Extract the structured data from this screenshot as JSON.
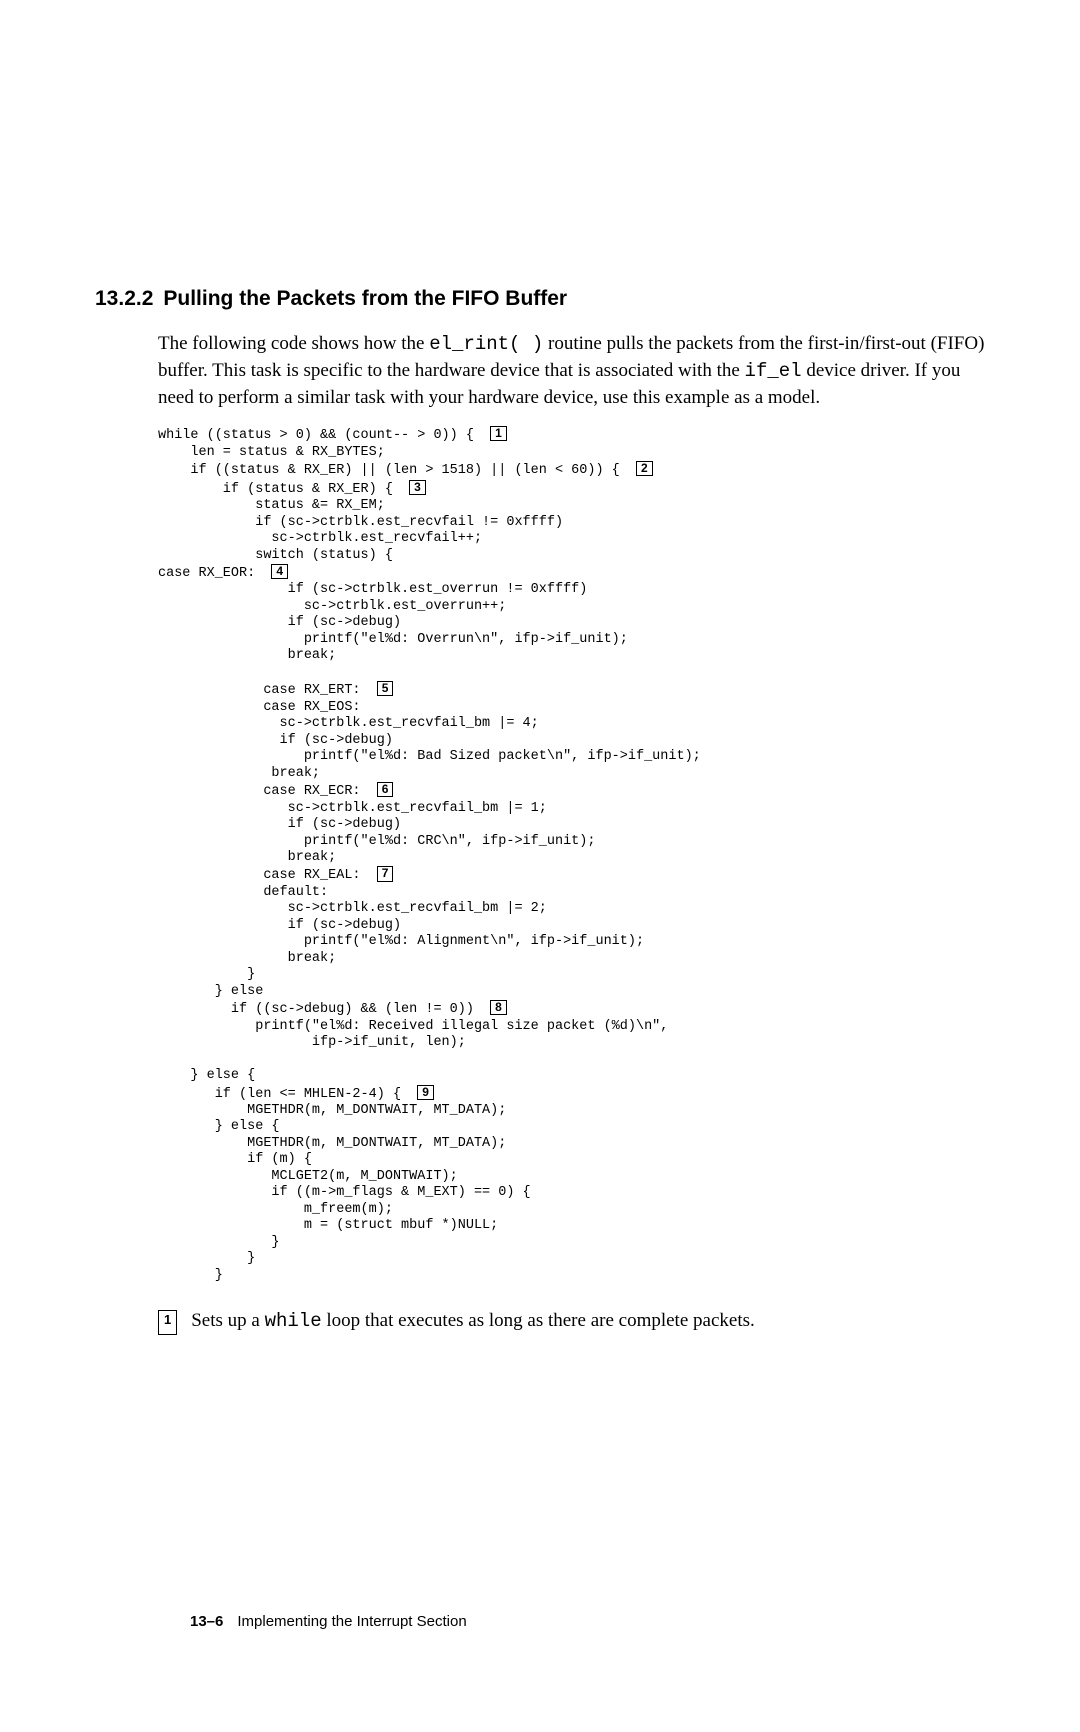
{
  "section": {
    "number": "13.2.2",
    "title": "Pulling the Packets from the FIFO Buffer"
  },
  "intro": {
    "text_before_code1": "The following code shows how the ",
    "code1": "el_rint( )",
    "text_mid1": " routine pulls the packets from the first-in/first-out (FIFO) buffer. This task is specific to the hardware device that is associated with the ",
    "code2": "if_el",
    "text_after_code2": " device driver. If you need to perform a similar task with your hardware device, use this example as a model."
  },
  "code": {
    "l1a": "while ((status > 0) && (count-- > 0)) {  ",
    "c1": "1",
    "l2": "    len = status & RX_BYTES;",
    "l3a": "    if ((status & RX_ER) || (len > 1518) || (len < 60)) {  ",
    "c2": "2",
    "l4a": "        if (status & RX_ER) {  ",
    "c3": "3",
    "l5": "            status &= RX_EM;",
    "l6": "            if (sc->ctrblk.est_recvfail != 0xffff)",
    "l7": "              sc->ctrblk.est_recvfail++;",
    "l8": "            switch (status) {",
    "l9a": "case RX_EOR:  ",
    "c4": "4",
    "l10": "                if (sc->ctrblk.est_overrun != 0xffff)",
    "l11": "                  sc->ctrblk.est_overrun++;",
    "l12": "                if (sc->debug)",
    "l13": "                  printf(\"el%d: Overrun\\n\", ifp->if_unit);",
    "l14": "                break;",
    "l15": "",
    "l16a": "             case RX_ERT:  ",
    "c5": "5",
    "l17": "             case RX_EOS:",
    "l18": "               sc->ctrblk.est_recvfail_bm |= 4;",
    "l19": "               if (sc->debug)",
    "l20": "                  printf(\"el%d: Bad Sized packet\\n\", ifp->if_unit);",
    "l21": "              break;",
    "l22a": "             case RX_ECR:  ",
    "c6": "6",
    "l23": "                sc->ctrblk.est_recvfail_bm |= 1;",
    "l24": "                if (sc->debug)",
    "l25": "                  printf(\"el%d: CRC\\n\", ifp->if_unit);",
    "l26": "                break;",
    "l27a": "             case RX_EAL:  ",
    "c7": "7",
    "l28": "             default:",
    "l29": "                sc->ctrblk.est_recvfail_bm |= 2;",
    "l30": "                if (sc->debug)",
    "l31": "                  printf(\"el%d: Alignment\\n\", ifp->if_unit);",
    "l32": "                break;",
    "l33": "           }",
    "l34": "       } else",
    "l35a": "         if ((sc->debug) && (len != 0))  ",
    "c8": "8",
    "l36": "            printf(\"el%d: Received illegal size packet (%d)\\n\",",
    "l37": "                   ifp->if_unit, len);",
    "l38": "",
    "l39": "    } else {",
    "l40a": "       if (len <= MHLEN-2-4) {  ",
    "c9": "9",
    "l41": "           MGETHDR(m, M_DONTWAIT, MT_DATA);",
    "l42": "       } else {",
    "l43": "           MGETHDR(m, M_DONTWAIT, MT_DATA);",
    "l44": "           if (m) {",
    "l45": "              MCLGET2(m, M_DONTWAIT);",
    "l46": "              if ((m->m_flags & M_EXT) == 0) {",
    "l47": "                  m_freem(m);",
    "l48": "                  m = (struct mbuf *)NULL;",
    "l49": "              }",
    "l50": "           }",
    "l51": "       }"
  },
  "callouts": [
    {
      "num": "1",
      "text_before": "Sets up a ",
      "code": "while",
      "text_after": " loop that executes as long as there are complete packets."
    }
  ],
  "footer": {
    "page": "13–6",
    "title": "Implementing the Interrupt Section"
  }
}
